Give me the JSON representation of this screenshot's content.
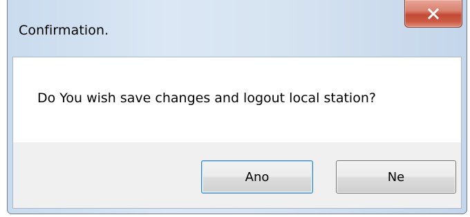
{
  "dialog": {
    "title": "Confirmation.",
    "close_icon": "close-icon",
    "message": "Do You wish save changes and logout local station?",
    "buttons": {
      "yes_label": "Ano",
      "no_label": "Ne"
    }
  },
  "colors": {
    "close_button": "#c24a36",
    "frame": "#c9dbee",
    "content_bg": "#ffffff",
    "footer_bg": "#f0f0f0"
  }
}
